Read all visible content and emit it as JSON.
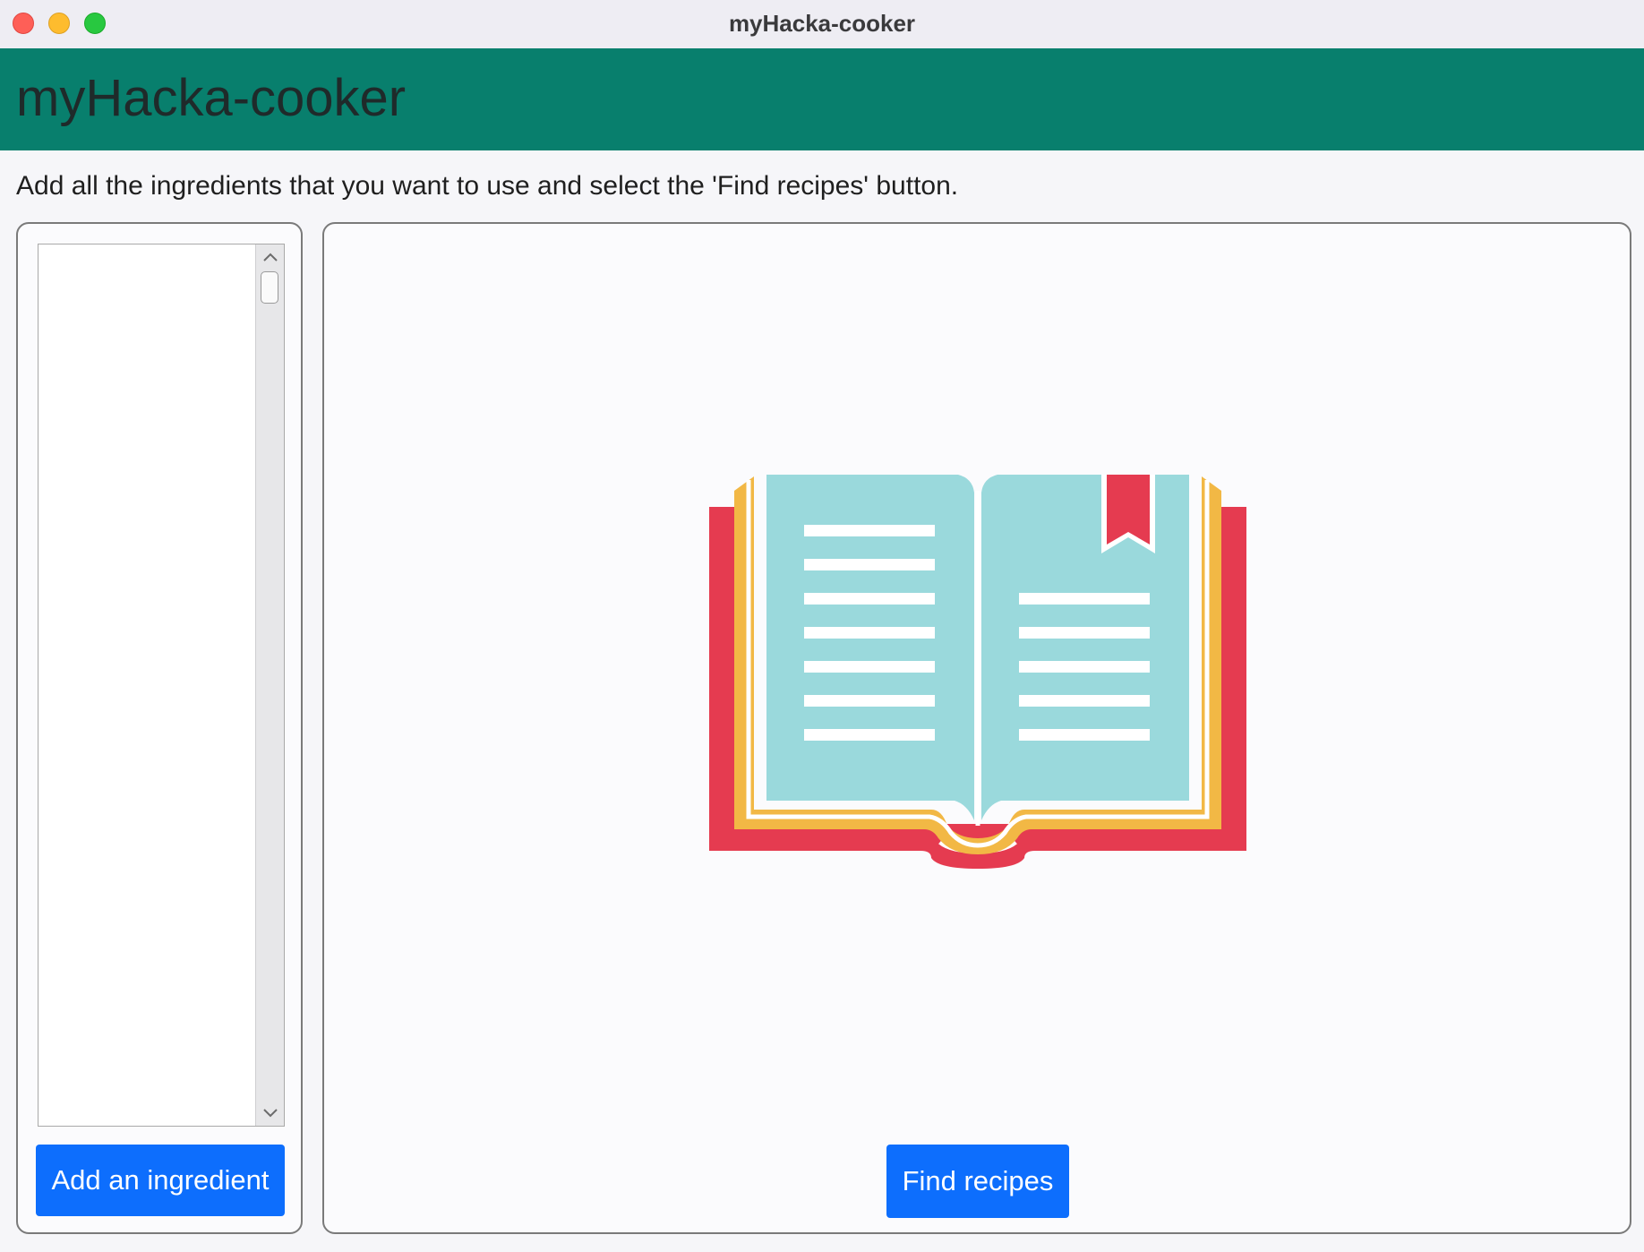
{
  "window": {
    "title": "myHacka-cooker"
  },
  "header": {
    "title": "myHacka-cooker"
  },
  "instructions": "Add all the ingredients that you want to use and select the 'Find recipes' button.",
  "ingredients": {
    "items": []
  },
  "buttons": {
    "add_ingredient": "Add an ingredient",
    "find_recipes": "Find recipes"
  },
  "colors": {
    "header_bg": "#087f6d",
    "button_bg": "#0d6efd",
    "book_cover": "#e53b50",
    "book_pages_edge": "#f2b845",
    "book_pages": "#9ad9dc",
    "bookmark": "#e53b50"
  },
  "icons": {
    "illustration": "open-book-icon",
    "scroll_up": "chevron-up-icon",
    "scroll_down": "chevron-down-icon"
  }
}
